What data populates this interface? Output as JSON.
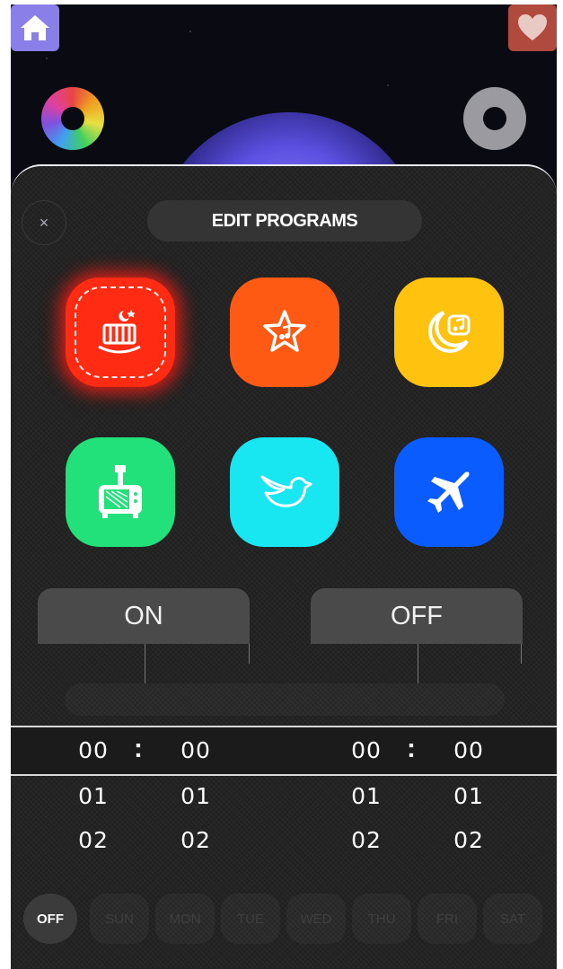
{
  "header": {
    "home_icon": "home-icon",
    "favorite_icon": "heart-icon"
  },
  "dialog": {
    "title": "EDIT PROGRAMS",
    "close_label": "×",
    "programs": [
      {
        "name": "crib-program",
        "icon": "crib-moon-icon",
        "color": "#ff2b12",
        "selected": true
      },
      {
        "name": "star-music-program",
        "icon": "star-music-icon",
        "color": "#ff5a14"
      },
      {
        "name": "moon-music-program",
        "icon": "moon-music-icon",
        "color": "#ffc20e"
      },
      {
        "name": "tv-program",
        "icon": "tv-icon",
        "color": "#22e07a"
      },
      {
        "name": "bird-program",
        "icon": "bird-icon",
        "color": "#18e6f0"
      },
      {
        "name": "airplane-program",
        "icon": "airplane-icon",
        "color": "#0a5cff"
      }
    ],
    "on_label": "ON",
    "off_label": "OFF"
  },
  "timer": {
    "on": {
      "hours": [
        "00",
        "01",
        "02"
      ],
      "minutes": [
        "00",
        "01",
        "02"
      ]
    },
    "off": {
      "hours": [
        "00",
        "01",
        "02"
      ],
      "minutes": [
        "00",
        "01",
        "02"
      ]
    },
    "separator": ":"
  },
  "days": [
    "OFF",
    "SUN",
    "MON",
    "TUE",
    "WED",
    "THU",
    "FRI",
    "SAT"
  ],
  "active_day": "OFF"
}
